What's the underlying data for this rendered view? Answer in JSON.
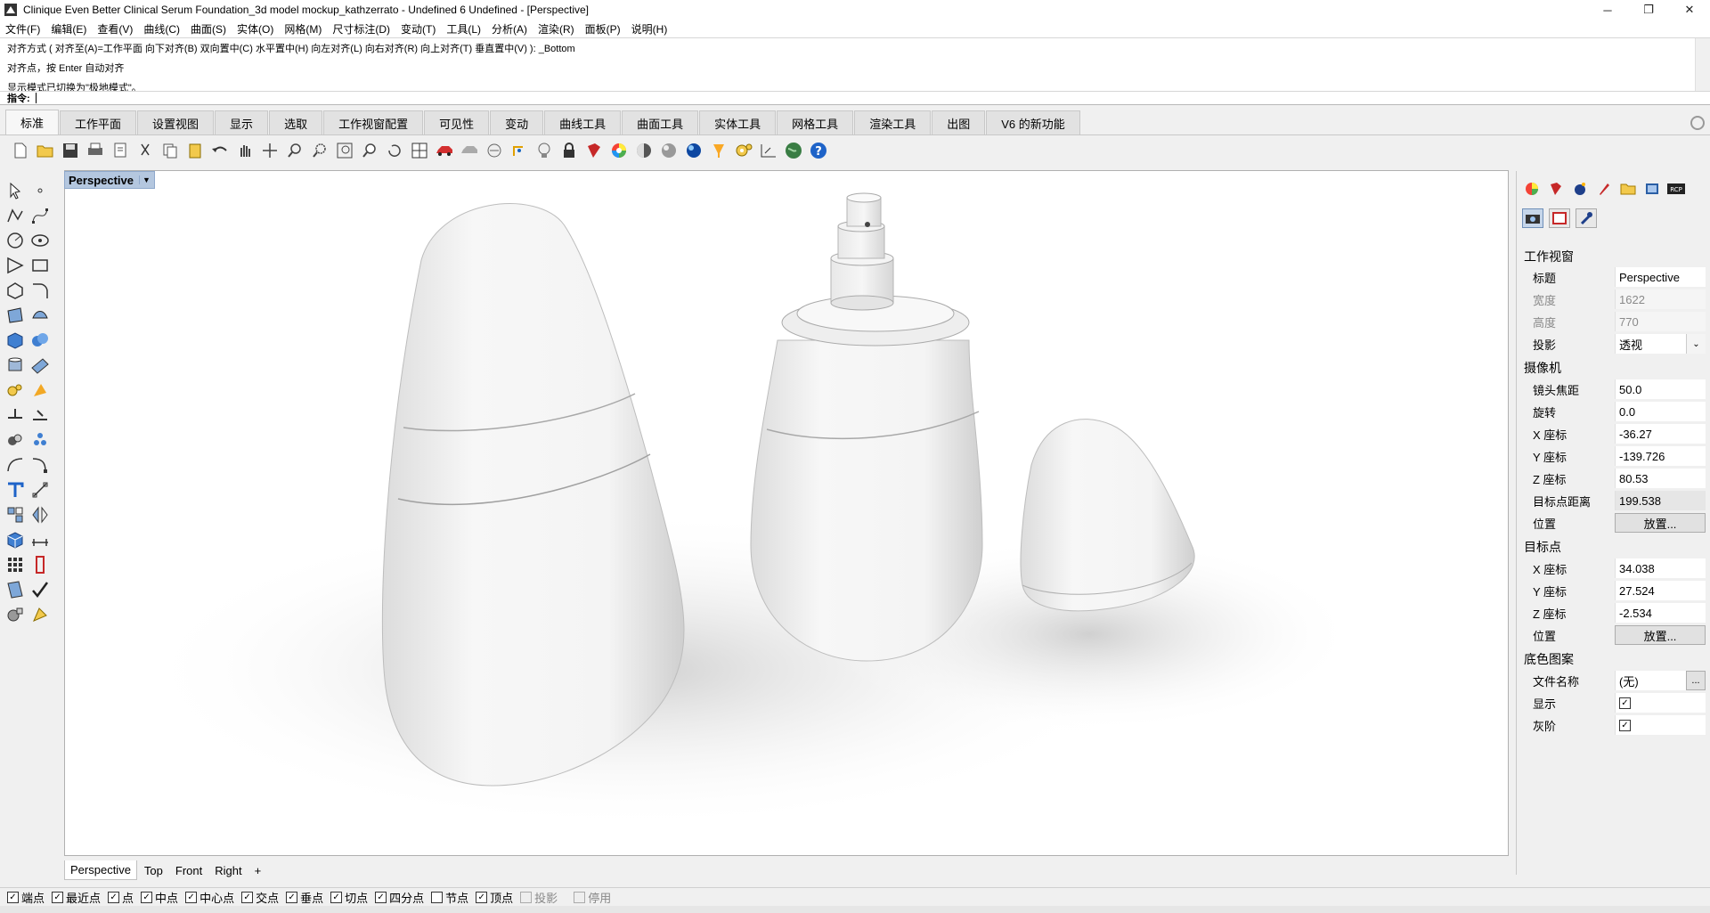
{
  "window": {
    "title": "Clinique Even Better Clinical Serum Foundation_3d model mockup_kathzerrato - Undefined 6 Undefined - [Perspective]",
    "controls": [
      "─",
      "❐",
      "✕"
    ]
  },
  "menu": [
    "文件(F)",
    "编辑(E)",
    "查看(V)",
    "曲线(C)",
    "曲面(S)",
    "实体(O)",
    "网格(M)",
    "尺寸标注(D)",
    "变动(T)",
    "工具(L)",
    "分析(A)",
    "渲染(R)",
    "面板(P)",
    "说明(H)"
  ],
  "command_history": [
    "对齐方式 ( 对齐至(A)=工作平面  向下对齐(B)  双向置中(C)  水平置中(H)  向左对齐(L)  向右对齐(R)  向上对齐(T)  垂直置中(V) ): _Bottom",
    "对齐点，按 Enter 自动对齐",
    "显示模式已切换为\"极地模式\"。"
  ],
  "command_prompt": "指令:",
  "tabs": [
    "标准",
    "工作平面",
    "设置视图",
    "显示",
    "选取",
    "工作视窗配置",
    "可见性",
    "变动",
    "曲线工具",
    "曲面工具",
    "实体工具",
    "网格工具",
    "渲染工具",
    "出图",
    "V6 的新功能"
  ],
  "active_tab": "标准",
  "toolbar_icons": [
    "new-icon",
    "open-icon",
    "save-icon",
    "print-icon",
    "import-icon",
    "cut-icon",
    "copy-icon",
    "paste-icon",
    "undo-icon",
    "pan-icon",
    "move-view-icon",
    "zoom-icon",
    "zoom-window-icon",
    "zoom-extents-icon",
    "zoom-selected-icon",
    "rotate-view-icon",
    "four-viewports-icon",
    "car-icon",
    "camera-icon",
    "named-view-icon",
    "gumball-icon",
    "light-icon",
    "lock-icon",
    "material-icon",
    "color-icon",
    "shade-icon",
    "render-icon",
    "light-tools-icon",
    "gear-tools-icon",
    "dimension-icon",
    "globe-icon",
    "help-icon"
  ],
  "viewport": {
    "name": "Perspective",
    "tabs": [
      "Perspective",
      "Top",
      "Front",
      "Right"
    ],
    "add_tab": "+"
  },
  "properties": {
    "section_viewport": "工作视窗",
    "title_label": "标题",
    "title_value": "Perspective",
    "width_label": "宽度",
    "width_value": "1622",
    "height_label": "高度",
    "height_value": "770",
    "projection_label": "投影",
    "projection_value": "透视",
    "section_camera": "摄像机",
    "lens_label": "镜头焦距",
    "lens_value": "50.0",
    "rotation_label": "旋转",
    "rotation_value": "0.0",
    "cx_label": "X 座标",
    "cx_value": "-36.27",
    "cy_label": "Y 座标",
    "cy_value": "-139.726",
    "cz_label": "Z 座标",
    "cz_value": "80.53",
    "target_distance_label": "目标点距离",
    "target_distance_value": "199.538",
    "cam_location_label": "位置",
    "place_button": "放置...",
    "section_target": "目标点",
    "tx_label": "X 座标",
    "tx_value": "34.038",
    "ty_label": "Y 座标",
    "ty_value": "27.524",
    "tz_label": "Z 座标",
    "tz_value": "-2.534",
    "target_location_label": "位置",
    "section_wallpaper": "底色图案",
    "filename_label": "文件名称",
    "filename_value": "(无)",
    "browse_button": "...",
    "show_label": "显示",
    "gray_label": "灰阶"
  },
  "osnaps": [
    {
      "label": "端点",
      "checked": true
    },
    {
      "label": "最近点",
      "checked": true
    },
    {
      "label": "点",
      "checked": true
    },
    {
      "label": "中点",
      "checked": true
    },
    {
      "label": "中心点",
      "checked": true
    },
    {
      "label": "交点",
      "checked": true
    },
    {
      "label": "垂点",
      "checked": true
    },
    {
      "label": "切点",
      "checked": true
    },
    {
      "label": "四分点",
      "checked": true
    },
    {
      "label": "节点",
      "checked": false
    },
    {
      "label": "顶点",
      "checked": true
    },
    {
      "label": "投影",
      "checked": false,
      "disabled": true
    },
    {
      "label": "停用",
      "checked": false,
      "disabled": true
    }
  ],
  "colors": {
    "viewport_label_bg": "#b4c7df",
    "active_tab_bg": "#f7f7f7"
  }
}
